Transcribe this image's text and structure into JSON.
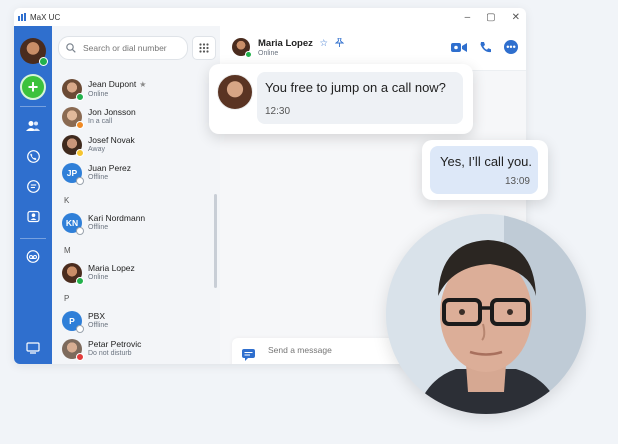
{
  "window": {
    "title": "MaX UC"
  },
  "search": {
    "placeholder": "Search or dial number"
  },
  "contacts": [
    {
      "name": "Jean Dupont",
      "status": "Online",
      "favorite": true,
      "presence": "green",
      "initials": ""
    },
    {
      "name": "Jon Jonsson",
      "status": "In a call",
      "presence": "orange",
      "initials": ""
    },
    {
      "name": "Josef Novak",
      "status": "Away",
      "presence": "yellow",
      "initials": ""
    },
    {
      "name": "Juan Perez",
      "status": "Offline",
      "presence": "grey",
      "initials": "JP"
    },
    {
      "name": "Kari Nordmann",
      "status": "Offline",
      "presence": "grey",
      "initials": "KN"
    },
    {
      "name": "Maria Lopez",
      "status": "Online",
      "presence": "green",
      "initials": ""
    },
    {
      "name": "PBX",
      "status": "Offline",
      "presence": "grey",
      "initials": "P"
    },
    {
      "name": "Petar Petrovic",
      "status": "Do not disturb",
      "presence": "red",
      "initials": ""
    }
  ],
  "section_letters": [
    "K",
    "M",
    "P"
  ],
  "chat": {
    "contact_name": "Maria Lopez",
    "contact_status": "Online",
    "composer_placeholder": "Send a message"
  },
  "messages": [
    {
      "direction": "in",
      "text": "You free to jump on a call now?",
      "time": "12:30"
    },
    {
      "direction": "out",
      "text": "Yes, I’ll call you.",
      "time": "13:09"
    }
  ],
  "colors": {
    "brand_blue": "#2f6fce",
    "online": "#22b14c",
    "in_call": "#f08a24",
    "away": "#f5c531",
    "dnd": "#e23b3b"
  }
}
